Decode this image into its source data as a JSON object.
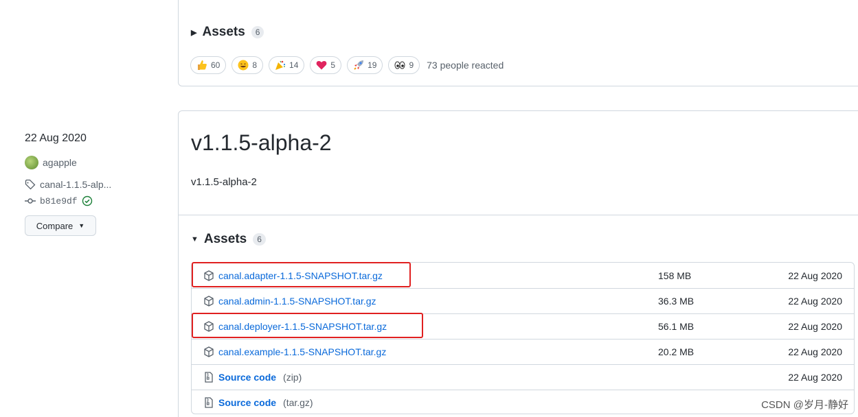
{
  "prev_release": {
    "assets_label": "Assets",
    "assets_count": "6",
    "reactions": [
      {
        "icon": "thumbs-up-icon",
        "count": "60"
      },
      {
        "icon": "laugh-icon",
        "count": "8"
      },
      {
        "icon": "hooray-icon",
        "count": "14"
      },
      {
        "icon": "heart-icon",
        "count": "5"
      },
      {
        "icon": "rocket-icon",
        "count": "19"
      },
      {
        "icon": "eyes-icon",
        "count": "9"
      }
    ],
    "people_reacted": "73 people reacted"
  },
  "release": {
    "date": "22 Aug 2020",
    "author": "agapple",
    "tag": "canal-1.1.5-alp...",
    "commit": "b81e9df",
    "compare_label": "Compare",
    "title": "v1.1.5-alpha-2",
    "body": "v1.1.5-alpha-2",
    "assets_label": "Assets",
    "assets_count": "6",
    "assets": [
      {
        "name": "canal.adapter-1.1.5-SNAPSHOT.tar.gz",
        "sub": "",
        "size": "158 MB",
        "date": "22 Aug 2020",
        "icon": "package-icon",
        "highlighted": true
      },
      {
        "name": "canal.admin-1.1.5-SNAPSHOT.tar.gz",
        "sub": "",
        "size": "36.3 MB",
        "date": "22 Aug 2020",
        "icon": "package-icon",
        "highlighted": false
      },
      {
        "name": "canal.deployer-1.1.5-SNAPSHOT.tar.gz",
        "sub": "",
        "size": "56.1 MB",
        "date": "22 Aug 2020",
        "icon": "package-icon",
        "highlighted": true
      },
      {
        "name": "canal.example-1.1.5-SNAPSHOT.tar.gz",
        "sub": "",
        "size": "20.2 MB",
        "date": "22 Aug 2020",
        "icon": "package-icon",
        "highlighted": false
      },
      {
        "name": "Source code",
        "sub": "(zip)",
        "size": "",
        "date": "22 Aug 2020",
        "icon": "file-zip-icon",
        "highlighted": false
      },
      {
        "name": "Source code",
        "sub": "(tar.gz)",
        "size": "",
        "date": "",
        "icon": "file-zip-icon",
        "highlighted": false
      }
    ]
  },
  "watermark": "CSDN @岁月-静好",
  "colors": {
    "link": "#0969da",
    "highlight": "#e02020",
    "border": "#d0d7de",
    "verified": "#1a7f37"
  }
}
